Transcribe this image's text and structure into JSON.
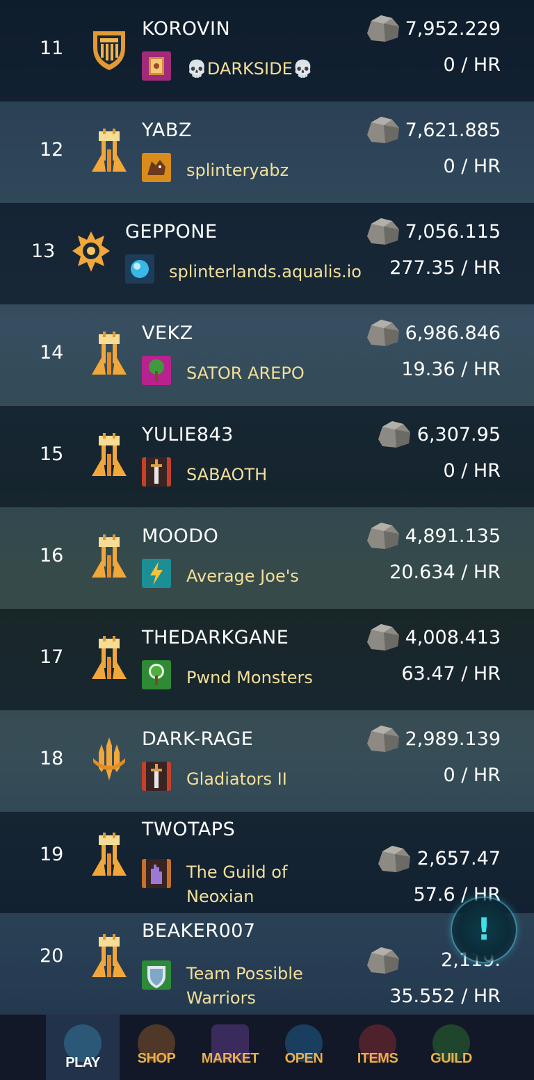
{
  "rows": [
    {
      "rank": "11",
      "name": "KOROVIN",
      "guild": "💀DARKSIDE💀",
      "guild_icon": "book-icon",
      "emblem": "shield-emblem",
      "value": "7,952.229",
      "rate": "0 / HR"
    },
    {
      "rank": "12",
      "name": "YABZ",
      "guild": "splinteryabz",
      "guild_icon": "wolf-icon",
      "emblem": "tower-emblem",
      "value": "7,621.885",
      "rate": "0 / HR"
    },
    {
      "rank": "13",
      "name": "GEPPONE",
      "guild": "splinterlands.aqualis.io",
      "guild_icon": "orb-icon",
      "emblem": "sun-emblem",
      "value": "7,056.115",
      "rate": "277.35 / HR"
    },
    {
      "rank": "14",
      "name": "VEKZ",
      "guild": "SATOR AREPO",
      "guild_icon": "tree-icon",
      "emblem": "tower-emblem",
      "value": "6,986.846",
      "rate": "19.36 / HR"
    },
    {
      "rank": "15",
      "name": "YULIE843",
      "guild": "SABAOTH",
      "guild_icon": "sword-icon",
      "emblem": "tower-emblem",
      "value": "6,307.95",
      "rate": "0 / HR"
    },
    {
      "rank": "16",
      "name": "MOODO",
      "guild": "Average Joe's",
      "guild_icon": "lightning-icon",
      "emblem": "tower-emblem",
      "value": "4,891.135",
      "rate": "20.634 / HR"
    },
    {
      "rank": "17",
      "name": "THEDARKGANE",
      "guild": "Pwnd Monsters",
      "guild_icon": "tree-icon",
      "emblem": "tower-emblem",
      "value": "4,008.413",
      "rate": "63.47 / HR"
    },
    {
      "rank": "18",
      "name": "DARK-RAGE",
      "guild": "Gladiators II",
      "guild_icon": "sword-icon",
      "emblem": "trident-emblem",
      "value": "2,989.139",
      "rate": "0 / HR"
    },
    {
      "rank": "19",
      "name": "TWOTAPS",
      "guild_line1": "The Guild of",
      "guild_line2": "Neoxian",
      "guild_icon": "hand-icon",
      "emblem": "tower-emblem",
      "value": "2,657.47",
      "rate": "57.6 / HR"
    },
    {
      "rank": "20",
      "name": "BEAKER007",
      "guild_line1": "Team Possible",
      "guild_line2": "Warriors",
      "guild_icon": "shield-icon",
      "emblem": "tower-emblem",
      "value": "2,119.",
      "rate": "35.552 / HR"
    }
  ],
  "alert": {
    "glyph": "!"
  },
  "nav": [
    {
      "label": "PLAY",
      "icon": "fist-icon",
      "active": true
    },
    {
      "label": "SHOP",
      "icon": "shop-icon"
    },
    {
      "label": "MARKET",
      "icon": "market-icon"
    },
    {
      "label": "OPEN",
      "icon": "open-icon"
    },
    {
      "label": "ITEMS",
      "icon": "items-icon"
    },
    {
      "label": "GUILD",
      "icon": "guild-icon"
    }
  ],
  "colors": {
    "gold": "#e9a23b",
    "guild_text": "#f3df9a",
    "nav_label": "#e9b04c"
  }
}
